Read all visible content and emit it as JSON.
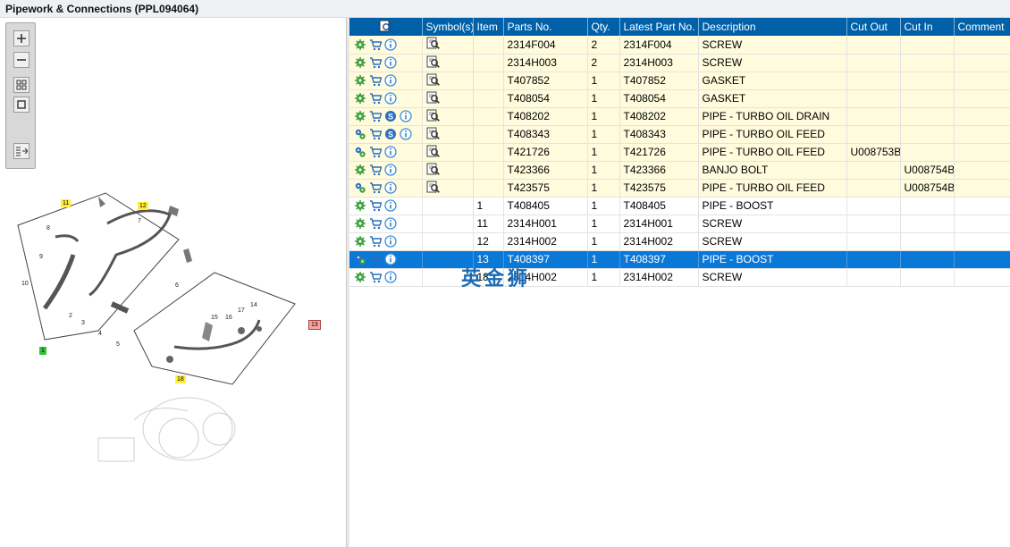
{
  "window": {
    "title": "Pipework & Connections (PPL094064)"
  },
  "toolbar": {
    "buttons": [
      "zoom-in",
      "zoom-out",
      "fit-all",
      "fit-page",
      "toggle-panel"
    ]
  },
  "diagram": {
    "callouts_highlight": [
      "11",
      "12",
      "18"
    ],
    "callout_green": "1",
    "callout_red": "13",
    "labels": [
      "8",
      "7",
      "9",
      "6",
      "10",
      "2",
      "3",
      "4",
      "5",
      "15",
      "16",
      "17",
      "14"
    ]
  },
  "grid": {
    "columns": [
      "",
      "Symbol(s)",
      "Item",
      "Parts No.",
      "Qty.",
      "Latest Part No.",
      "Description",
      "Cut Out",
      "Cut In",
      "Comment"
    ],
    "rows": [
      {
        "highlight": true,
        "selected": false,
        "icons": [
          "gear",
          "cart",
          "info"
        ],
        "symbol": true,
        "item": "",
        "part": "2314F004",
        "qty": "2",
        "latest": "2314F004",
        "desc": "SCREW",
        "cutout": "",
        "cutin": "",
        "comment": ""
      },
      {
        "highlight": true,
        "selected": false,
        "icons": [
          "gear",
          "cart",
          "info"
        ],
        "symbol": true,
        "item": "",
        "part": "2314H003",
        "qty": "2",
        "latest": "2314H003",
        "desc": "SCREW",
        "cutout": "",
        "cutin": "",
        "comment": ""
      },
      {
        "highlight": true,
        "selected": false,
        "icons": [
          "gear",
          "cart",
          "info"
        ],
        "symbol": true,
        "item": "",
        "part": "T407852",
        "qty": "1",
        "latest": "T407852",
        "desc": "GASKET",
        "cutout": "",
        "cutin": "",
        "comment": ""
      },
      {
        "highlight": true,
        "selected": false,
        "icons": [
          "gear",
          "cart",
          "info"
        ],
        "symbol": true,
        "item": "",
        "part": "T408054",
        "qty": "1",
        "latest": "T408054",
        "desc": "GASKET",
        "cutout": "",
        "cutin": "",
        "comment": ""
      },
      {
        "highlight": true,
        "selected": false,
        "icons": [
          "gear",
          "cart",
          "s",
          "info"
        ],
        "symbol": true,
        "item": "",
        "part": "T408202",
        "qty": "1",
        "latest": "T408202",
        "desc": "PIPE - TURBO OIL DRAIN",
        "cutout": "",
        "cutin": "",
        "comment": ""
      },
      {
        "highlight": true,
        "selected": false,
        "icons": [
          "gears",
          "cart",
          "s",
          "info"
        ],
        "symbol": true,
        "item": "",
        "part": "T408343",
        "qty": "1",
        "latest": "T408343",
        "desc": "PIPE - TURBO OIL FEED",
        "cutout": "",
        "cutin": "",
        "comment": ""
      },
      {
        "highlight": true,
        "selected": false,
        "icons": [
          "gears",
          "cart",
          "info"
        ],
        "symbol": true,
        "item": "",
        "part": "T421726",
        "qty": "1",
        "latest": "T421726",
        "desc": "PIPE - TURBO OIL FEED",
        "cutout": "U008753B",
        "cutin": "",
        "comment": ""
      },
      {
        "highlight": true,
        "selected": false,
        "icons": [
          "gear",
          "cart",
          "info"
        ],
        "symbol": true,
        "item": "",
        "part": "T423366",
        "qty": "1",
        "latest": "T423366",
        "desc": "BANJO BOLT",
        "cutout": "",
        "cutin": "U008754B",
        "comment": ""
      },
      {
        "highlight": true,
        "selected": false,
        "icons": [
          "gears",
          "cart",
          "info"
        ],
        "symbol": true,
        "item": "",
        "part": "T423575",
        "qty": "1",
        "latest": "T423575",
        "desc": "PIPE - TURBO OIL FEED",
        "cutout": "",
        "cutin": "U008754B",
        "comment": ""
      },
      {
        "highlight": false,
        "selected": false,
        "icons": [
          "gear",
          "cart",
          "info"
        ],
        "symbol": false,
        "item": "1",
        "part": "T408405",
        "qty": "1",
        "latest": "T408405",
        "desc": "PIPE - BOOST",
        "cutout": "",
        "cutin": "",
        "comment": ""
      },
      {
        "highlight": false,
        "selected": false,
        "icons": [
          "gear",
          "cart",
          "info"
        ],
        "symbol": false,
        "item": "11",
        "part": "2314H001",
        "qty": "1",
        "latest": "2314H001",
        "desc": "SCREW",
        "cutout": "",
        "cutin": "",
        "comment": ""
      },
      {
        "highlight": false,
        "selected": false,
        "icons": [
          "gear",
          "cart",
          "info"
        ],
        "symbol": false,
        "item": "12",
        "part": "2314H002",
        "qty": "1",
        "latest": "2314H002",
        "desc": "SCREW",
        "cutout": "",
        "cutin": "",
        "comment": ""
      },
      {
        "highlight": false,
        "selected": true,
        "icons": [
          "gears",
          "cart",
          "info"
        ],
        "symbol": false,
        "item": "13",
        "part": "T408397",
        "qty": "1",
        "latest": "T408397",
        "desc": "PIPE - BOOST",
        "cutout": "",
        "cutin": "",
        "comment": ""
      },
      {
        "highlight": false,
        "selected": false,
        "icons": [
          "gear",
          "cart",
          "info"
        ],
        "symbol": false,
        "item": "18",
        "part": "2314H002",
        "qty": "1",
        "latest": "2314H002",
        "desc": "SCREW",
        "cutout": "",
        "cutin": "",
        "comment": ""
      }
    ]
  },
  "watermark": "英金狮",
  "colors": {
    "header": "#0060a8",
    "highlight_row": "#fffbdc",
    "selected_row": "#0a78d7",
    "gear": "#3aa13a",
    "cart": "#2a6fc0",
    "info": "#3f8fd8"
  }
}
